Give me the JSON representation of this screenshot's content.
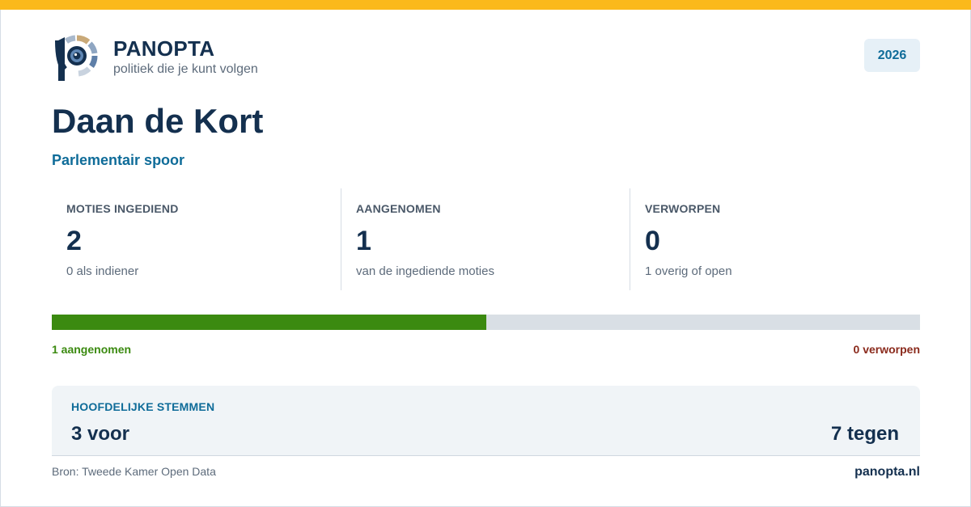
{
  "brand": {
    "name": "PANOPTA",
    "tagline": "politiek die je kunt volgen",
    "year": "2026"
  },
  "person": {
    "name": "Daan de Kort",
    "subtitle": "Parlementair spoor"
  },
  "stats": [
    {
      "label": "MOTIES INGEDIEND",
      "value": "2",
      "sub": "0 als indiener"
    },
    {
      "label": "AANGENOMEN",
      "value": "1",
      "sub": "van de ingediende moties"
    },
    {
      "label": "VERWORPEN",
      "value": "0",
      "sub": "1 overig of open"
    }
  ],
  "progress": {
    "accepted_fraction": 0.5,
    "left_label": "1 aangenomen",
    "right_label": "0 verworpen"
  },
  "votes": {
    "title": "HOOFDELIJKE STEMMEN",
    "for": "3 voor",
    "against": "7 tegen"
  },
  "footer": {
    "source": "Bron: Tweede Kamer Open Data",
    "site": "panopta.nl"
  },
  "colors": {
    "accent_bar": "#fbb91b",
    "navy": "#14304f",
    "blue": "#0f6c99",
    "accepted": "#3b8a10",
    "rejected": "#8a2a1c"
  },
  "icons": {
    "logo": "panopta-eye-logo"
  }
}
